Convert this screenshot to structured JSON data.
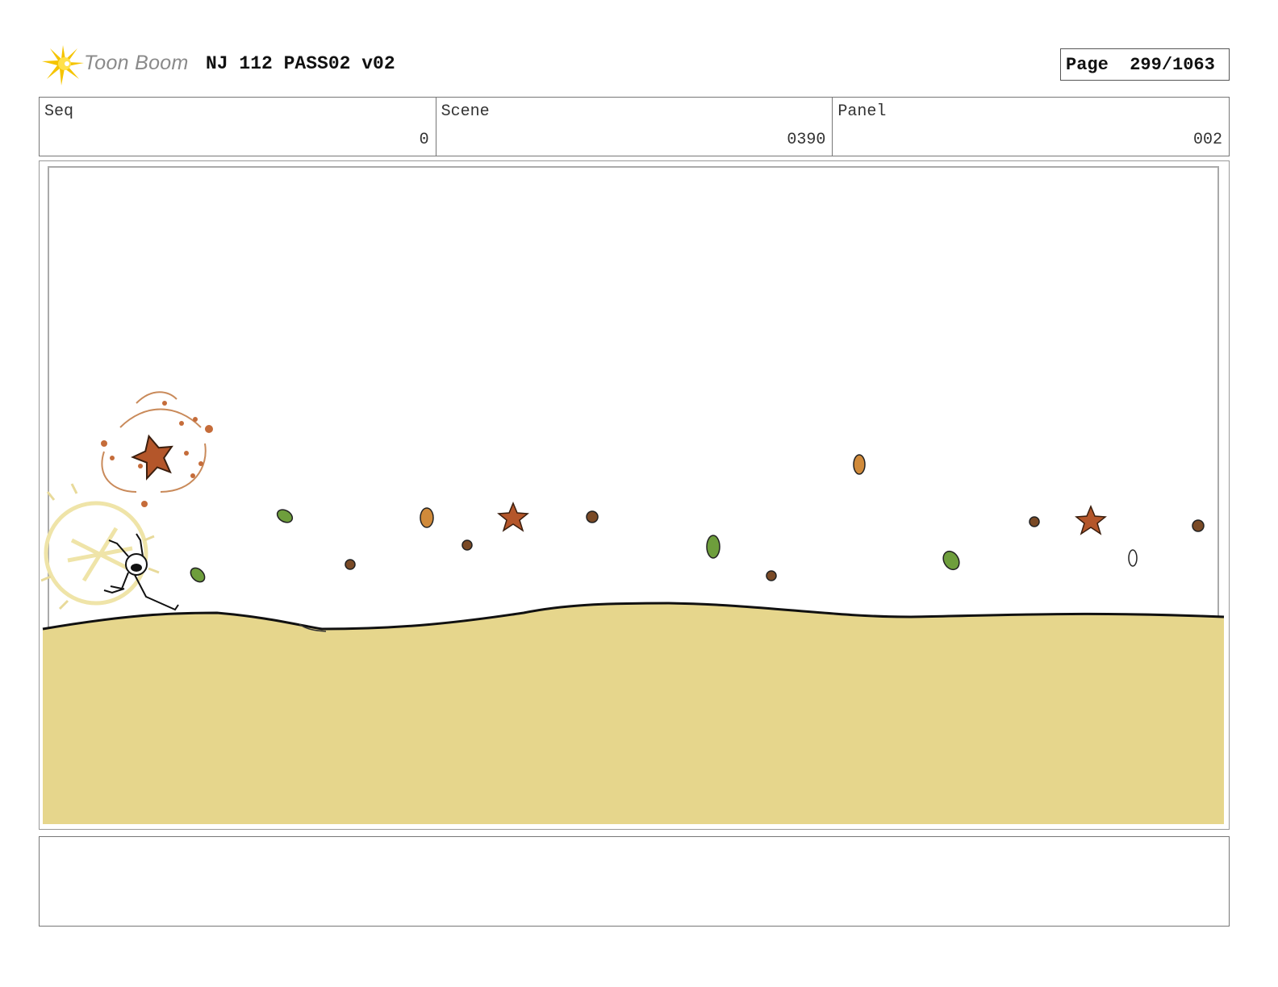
{
  "header": {
    "logo_text": "Toon Boom",
    "project_title": "NJ 112 PASS02 v02",
    "page_label": "Page",
    "page_number": "299/1063"
  },
  "info": {
    "seq_label": "Seq",
    "seq_value": "0",
    "scene_label": "Scene",
    "scene_value": "0390",
    "panel_label": "Panel",
    "panel_value": "002"
  },
  "colors": {
    "ground": "#e6d68c",
    "leaf_green": "#6e9e3c",
    "leaf_orange": "#d08a3a",
    "leaf_brown": "#7a4a26",
    "star_orange": "#b4562a",
    "logo_yellow": "#f5c400"
  },
  "notes": ""
}
